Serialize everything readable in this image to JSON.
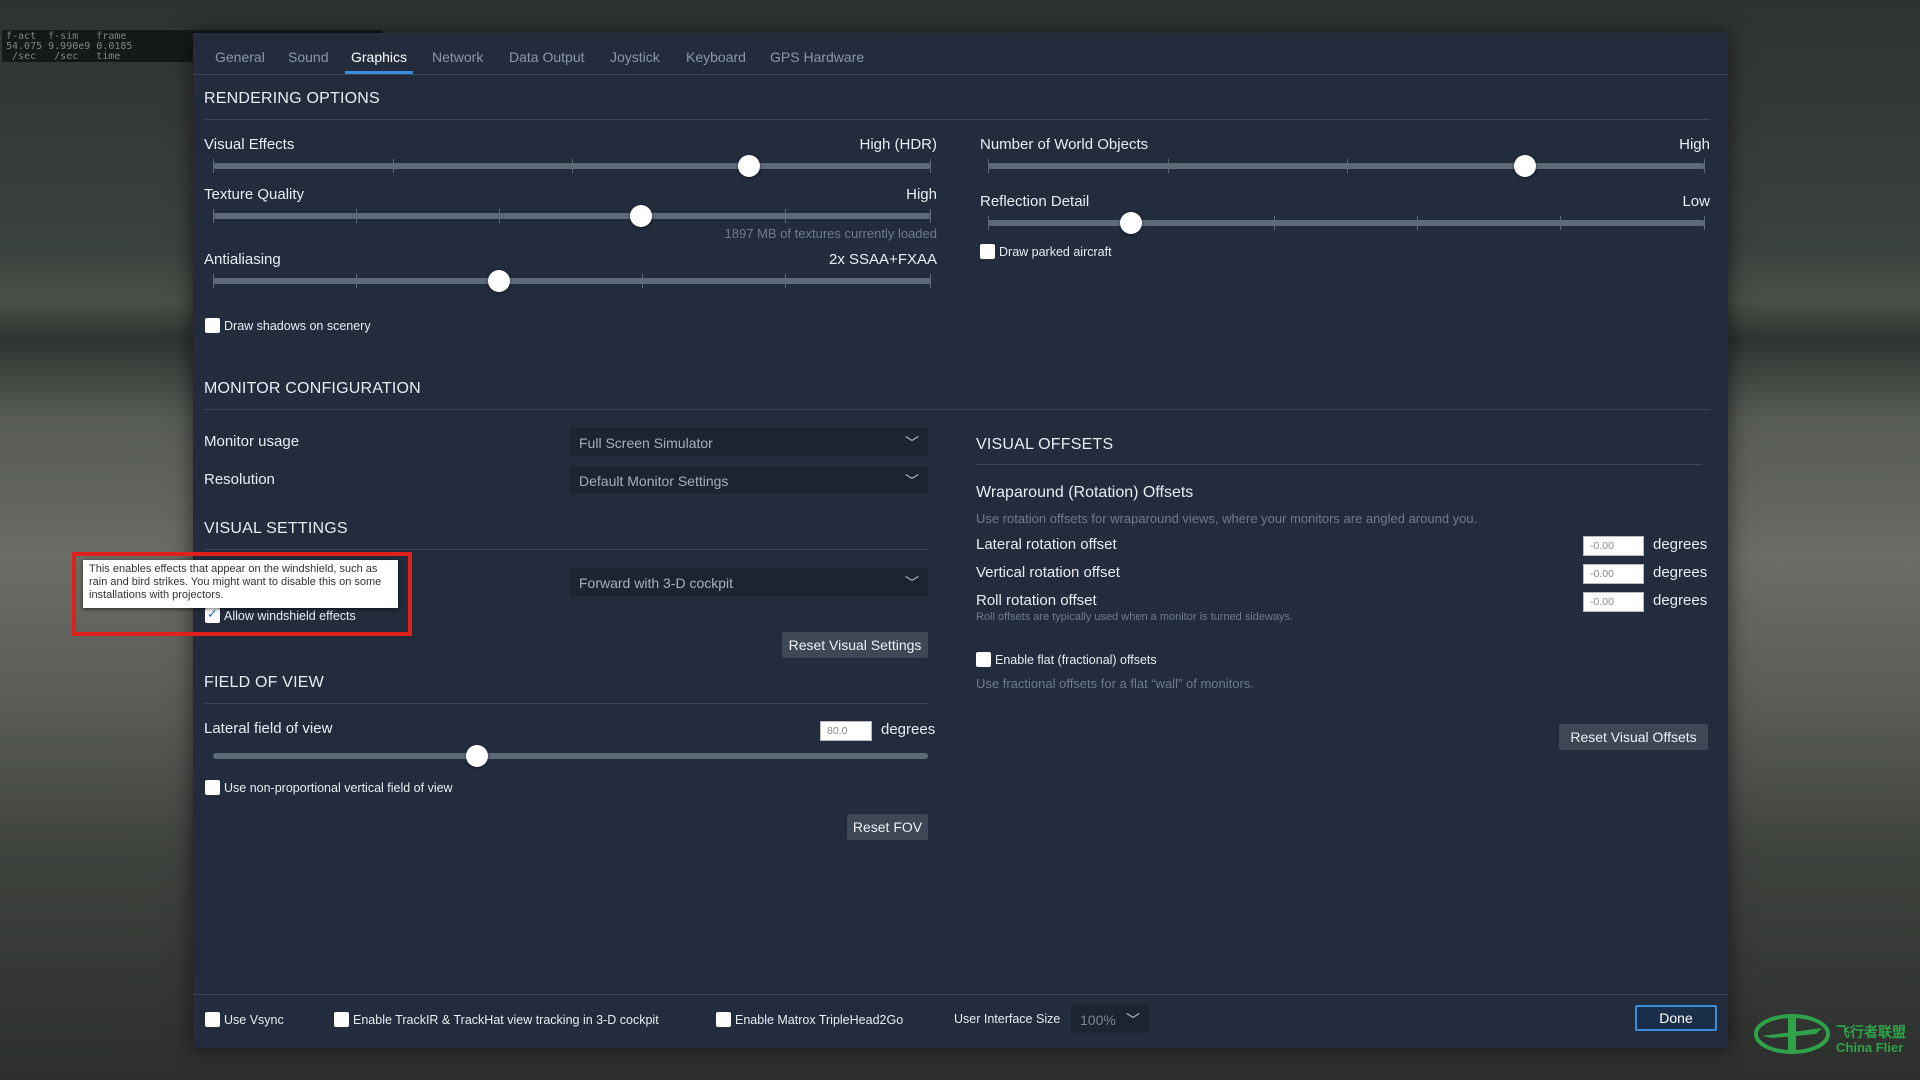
{
  "overlay": {
    "fps_text": "f-act  f-sim   frame\n54.075 9.990e9 0.0185\n /sec   /sec   time"
  },
  "tabs": [
    {
      "label": "General"
    },
    {
      "label": "Sound"
    },
    {
      "label": "Graphics",
      "active": true
    },
    {
      "label": "Network"
    },
    {
      "label": "Data Output"
    },
    {
      "label": "Joystick"
    },
    {
      "label": "Keyboard"
    },
    {
      "label": "GPS Hardware"
    }
  ],
  "rendering": {
    "title": "RENDERING OPTIONS",
    "visual_effects": {
      "label": "Visual Effects",
      "value": "High (HDR)",
      "level": 0.75
    },
    "texture_quality": {
      "label": "Texture Quality",
      "value": "High",
      "level": 0.6,
      "note": "1897 MB of textures currently loaded"
    },
    "antialiasing": {
      "label": "Antialiasing",
      "value": "2x SSAA+FXAA",
      "level": 0.4
    },
    "draw_shadows": {
      "label": "Draw shadows on scenery",
      "checked": false
    },
    "world_objects": {
      "label": "Number of World Objects",
      "value": "High",
      "level": 0.75
    },
    "reflection_detail": {
      "label": "Reflection Detail",
      "value": "Low",
      "level": 0.2
    },
    "draw_parked": {
      "label": "Draw parked aircraft",
      "checked": false
    }
  },
  "monitor": {
    "title": "MONITOR CONFIGURATION",
    "usage_label": "Monitor usage",
    "usage_value": "Full Screen Simulator",
    "resolution_label": "Resolution",
    "resolution_value": "Default Monitor Settings"
  },
  "visual_settings": {
    "title": "VISUAL SETTINGS",
    "view_value": "Forward with 3-D cockpit",
    "windshield": {
      "label": "Allow windshield effects",
      "checked": true
    },
    "tooltip": "This enables effects that appear on the windshield, such as rain and bird strikes. You might want to disable this on some installations with projectors.",
    "reset_label": "Reset Visual Settings"
  },
  "fov": {
    "title": "FIELD OF VIEW",
    "lateral_label": "Lateral field of view",
    "lateral_value": "80.0",
    "unit": "degrees",
    "level": 0.37,
    "nonprop": {
      "label": "Use non-proportional vertical field of view",
      "checked": false
    },
    "reset_label": "Reset FOV"
  },
  "visual_offsets": {
    "title": "VISUAL OFFSETS",
    "subtitle": "Wraparound (Rotation) Offsets",
    "description": "Use rotation offsets for wraparound views, where your monitors are angled around you.",
    "lateral": {
      "label": "Lateral rotation offset",
      "value": "-0.00",
      "unit": "degrees"
    },
    "vertical": {
      "label": "Vertical rotation offset",
      "value": "-0.00",
      "unit": "degrees"
    },
    "roll": {
      "label": "Roll rotation offset",
      "value": "-0.00",
      "unit": "degrees",
      "note": "Roll offsets are typically used when a monitor is turned sideways."
    },
    "flat": {
      "label": "Enable flat (fractional) offsets",
      "checked": false,
      "note": "Use fractional offsets for a flat “wall” of monitors."
    },
    "reset_label": "Reset Visual Offsets"
  },
  "bottom": {
    "vsync": {
      "label": "Use Vsync",
      "checked": false
    },
    "trackir": {
      "label": "Enable TrackIR & TrackHat view tracking in 3-D cockpit",
      "checked": false
    },
    "matrox": {
      "label": "Enable Matrox TripleHead2Go",
      "checked": false
    },
    "ui_size_label": "User Interface Size",
    "ui_size_value": "100%",
    "done_label": "Done"
  },
  "watermark": {
    "cn": "飞行者联盟",
    "en": "China Flier"
  },
  "colors": {
    "accent": "#3b8edb",
    "highlight_box": "#e0201c",
    "panel": "#222c3c"
  }
}
